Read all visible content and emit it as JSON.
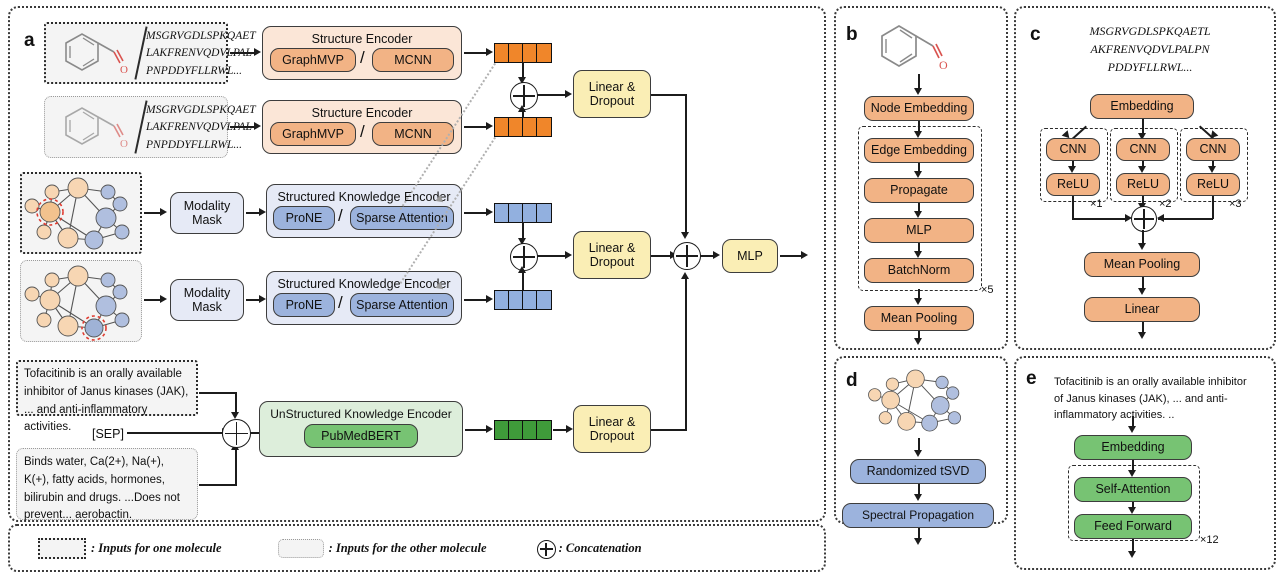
{
  "panels": {
    "a": {
      "letter": "a"
    },
    "b": {
      "letter": "b"
    },
    "c": {
      "letter": "c"
    },
    "d": {
      "letter": "d"
    },
    "e": {
      "letter": "e"
    }
  },
  "sequences": {
    "mol_seq_line1": "MSGRVGDLSPKQAET",
    "mol_seq_line2": "LAKFRENVQDVLPAL",
    "mol_seq_line3": "PNPDDYFLLRWL...",
    "panel_c_line1": "MSGRVGDLSPKQAETL",
    "panel_c_line2": "AKFRENVQDVLPALPN",
    "panel_c_line3": "PDDYFLLRWL..."
  },
  "panel_a": {
    "structure_encoder_title": "Structure Encoder",
    "structure_encoder_left": "GraphMVP",
    "structure_encoder_right": "MCNN",
    "structure_encoder_sep": "/",
    "modality_mask": "Modality\nMask",
    "modality_mask_l1": "Modality",
    "modality_mask_l2": "Mask",
    "structured_encoder_title": "Structured Knowledge Encoder",
    "structured_encoder_left": "ProNE",
    "structured_encoder_right": "Sparse Attention",
    "unstructured_encoder_title": "UnStructured Knowledge Encoder",
    "unstructured_encoder_inner": "PubMedBERT",
    "sep_token": "[SEP]",
    "linear_dropout_l1": "Linear &",
    "linear_dropout_l2": "Dropout",
    "mlp": "MLP",
    "text_box_1": "Tofacitinib is an orally available inhibitor of Janus kinases (JAK), ... and anti-inflammatory activities.",
    "text_box_2": "Binds water, Ca(2+), Na(+), K(+), fatty acids, hormones, bilirubin and drugs. ...Does not prevent... aerobactin."
  },
  "panel_b": {
    "steps": [
      "Node Embedding",
      "Edge Embedding",
      "Propagate",
      "MLP",
      "BatchNorm",
      "Mean Pooling"
    ],
    "repeat": "×5"
  },
  "panel_c": {
    "embedding": "Embedding",
    "branches": [
      {
        "conv": "CNN",
        "act": "ReLU",
        "repeat": "×1"
      },
      {
        "conv": "CNN",
        "act": "ReLU",
        "repeat": "×2"
      },
      {
        "conv": "CNN",
        "act": "ReLU",
        "repeat": "×3"
      }
    ],
    "mean_pooling": "Mean Pooling",
    "linear": "Linear"
  },
  "panel_d": {
    "steps": [
      "Randomized tSVD",
      "Spectral Propagation"
    ]
  },
  "panel_e": {
    "text": "Tofacitinib is an orally available inhibitor of Janus kinases (JAK), ... and anti-inflammatory activities. ..",
    "embedding": "Embedding",
    "self_attention": "Self-Attention",
    "feed_forward": "Feed Forward",
    "repeat": "×12"
  },
  "legend": {
    "item1": ": Inputs for one molecule",
    "item2": ": Inputs for the other molecule",
    "item3": ": Concatenation"
  },
  "colors": {
    "orange_strong": "#f0862a",
    "orange_box": "#f2b385",
    "orange_light": "#fbe6d7",
    "blue_strong": "#92b0df",
    "blue_box": "#9cb3dd",
    "blue_light": "#e6eaf6",
    "green_strong": "#3f9b3a",
    "green_box": "#77c373",
    "green_light": "#ddeedb",
    "yellow_box": "#faeeb5",
    "node_orange": "#f7d6b3",
    "node_blue": "#b0bfdf",
    "highlight_red": "#e03c31"
  }
}
